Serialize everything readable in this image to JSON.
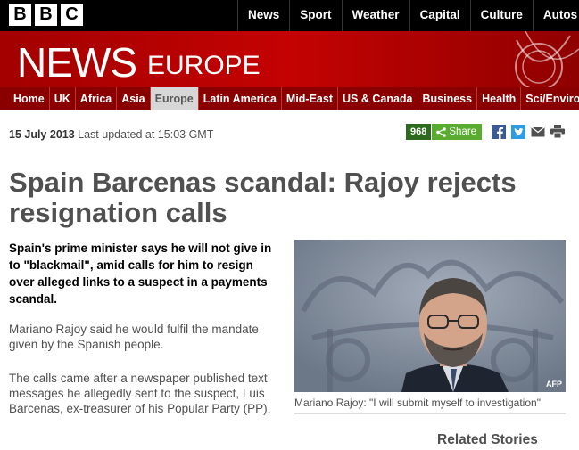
{
  "logo": {
    "letters": [
      "B",
      "B",
      "C"
    ]
  },
  "top_nav": [
    "News",
    "Sport",
    "Weather",
    "Capital",
    "Culture",
    "Autos"
  ],
  "banner": {
    "news": "NEWS",
    "region": "EUROPE"
  },
  "section_nav": [
    "Home",
    "UK",
    "Africa",
    "Asia",
    "Europe",
    "Latin America",
    "Mid-East",
    "US & Canada",
    "Business",
    "Health",
    "Sci/Environm"
  ],
  "active_section": "Europe",
  "dateline": {
    "date": "15 July 2013",
    "updated": "Last updated at 15:03 GMT"
  },
  "share": {
    "count": "968",
    "label": "Share"
  },
  "social_icons": [
    "facebook-icon",
    "twitter-icon",
    "email-icon",
    "print-icon"
  ],
  "article": {
    "headline": "Spain Barcenas scandal: Rajoy rejects resignation calls",
    "intro": "Spain's prime minister says he will not give in to \"blackmail\", amid calls for him to resign over alleged links to a suspect in a payments scandal.",
    "p1": "Mariano Rajoy said he would fulfil the mandate given by the Spanish people.",
    "p2": "The calls came after a newspaper published text messages he allegedly sent to the suspect, Luis Barcenas, ex-treasurer of his Popular Party (PP)."
  },
  "photo": {
    "credit": "AFP",
    "caption": "Mariano Rajoy: \"I will submit myself to investigation\""
  },
  "related": {
    "title": "Related Stories"
  },
  "colors": {
    "brand_red": "#c40202",
    "nav_dark_red": "#8a0000",
    "share_green": "#5aab2f"
  }
}
